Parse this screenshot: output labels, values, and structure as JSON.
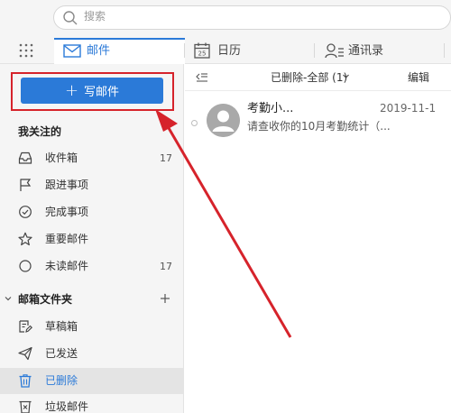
{
  "search": {
    "placeholder": "搜索"
  },
  "tabs": {
    "mail": "邮件",
    "calendar": "日历",
    "contacts": "通讯录"
  },
  "sidebar": {
    "compose_label": "写邮件",
    "followed_section": "我关注的",
    "followed_items": [
      {
        "icon": "inbox-icon",
        "label": "收件箱",
        "count": "17"
      },
      {
        "icon": "flag-icon",
        "label": "跟进事项",
        "count": ""
      },
      {
        "icon": "check-circle-icon",
        "label": "完成事项",
        "count": ""
      },
      {
        "icon": "star-icon",
        "label": "重要邮件",
        "count": ""
      },
      {
        "icon": "circle-icon",
        "label": "未读邮件",
        "count": "17"
      }
    ],
    "folders_section": "邮箱文件夹",
    "folder_items": [
      {
        "icon": "draft-icon",
        "label": "草稿箱"
      },
      {
        "icon": "send-icon",
        "label": "已发送"
      },
      {
        "icon": "trash-icon",
        "label": "已删除",
        "selected": true
      },
      {
        "icon": "spam-icon",
        "label": "垃圾邮件"
      }
    ]
  },
  "list": {
    "folder_title": "已删除-全部 (1)",
    "edit_label": "编辑",
    "messages": [
      {
        "sender": "考勤小...",
        "date": "2019-11-1",
        "preview": "请查收你的10月考勤统计（..."
      }
    ]
  },
  "colors": {
    "accent": "#2b7ad8",
    "annotation_red": "#d6232b",
    "sidebar_bg": "#f5f5f5",
    "selected_bg": "#e4e4e4"
  }
}
